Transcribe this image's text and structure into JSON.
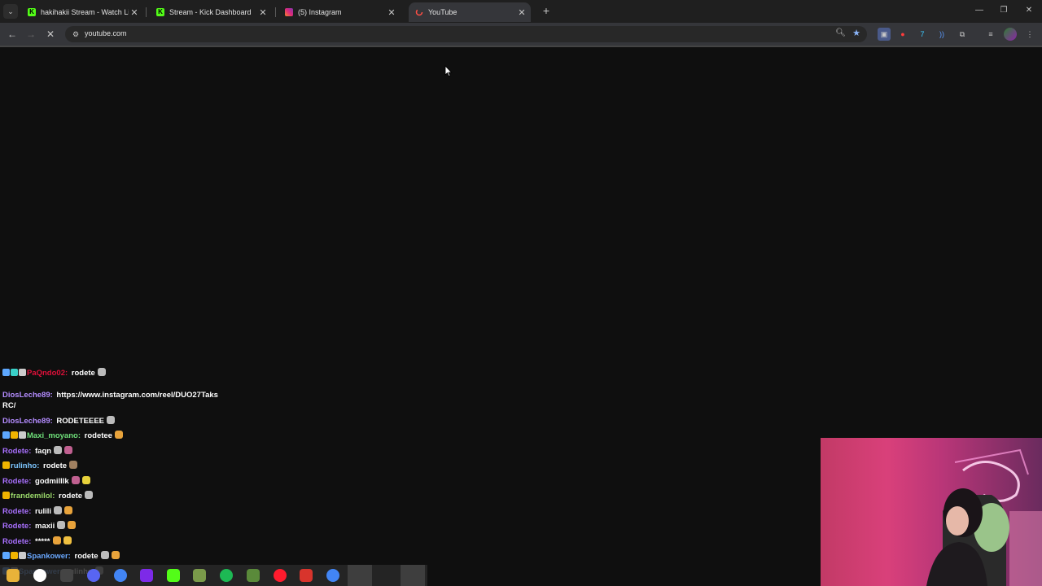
{
  "browser": {
    "tabs": [
      {
        "title": "hakihakii Stream - Watch Live o",
        "favicon": "kick",
        "favicon_color": "#53fc18",
        "active": false
      },
      {
        "title": "Stream - Kick Dashboard",
        "favicon": "kick",
        "favicon_color": "#53fc18",
        "active": false
      },
      {
        "title": "(5) Instagram",
        "favicon": "instagram",
        "favicon_color": "#e1306c",
        "active": false
      },
      {
        "title": "YouTube",
        "favicon": "youtube",
        "favicon_color": "#ff0000",
        "active": true
      }
    ],
    "close_glyph": "✕",
    "new_tab_glyph": "+",
    "window_controls": {
      "minimize": "—",
      "restore": "❐",
      "close": "✕"
    },
    "address": "youtube.com",
    "state": "loading"
  },
  "chat": {
    "messages": [
      {
        "user": "PaQndo02",
        "user_color": "#e0103a",
        "text": "rodete",
        "badges": [
          "#5da8ff",
          "#3ad0c8",
          "#cccccc"
        ],
        "emotes": [
          "#bbbbbb"
        ]
      },
      {
        "user": "DiosLeche89",
        "user_color": "#b48cff",
        "text": "https://www.instagram.com/reel/DUO27TaksRC/",
        "badges": [],
        "emotes": []
      },
      {
        "user": "DiosLeche89",
        "user_color": "#b48cff",
        "text": "RODETEEEE",
        "badges": [],
        "emotes": [
          "#bbbbbb"
        ]
      },
      {
        "user": "Maxi_moyano",
        "user_color": "#6fe07a",
        "text": "rodetee",
        "badges": [
          "#5da8ff",
          "#f0b400",
          "#cccccc"
        ],
        "emotes": [
          "#e8a33b"
        ]
      },
      {
        "user": "Rodete",
        "user_color": "#a970ff",
        "text": "faqn",
        "badges": [],
        "emotes": [
          "#bbbbbb",
          "#c06090"
        ]
      },
      {
        "user": "rulinho",
        "user_color": "#7dc6ff",
        "text": "rodete",
        "badges": [
          "#f0b400"
        ],
        "emotes": [
          "#a08060"
        ]
      },
      {
        "user": "Rodete",
        "user_color": "#a970ff",
        "text": "godmilllk",
        "badges": [],
        "emotes": [
          "#c06090",
          "#e8d23b"
        ]
      },
      {
        "user": "frandemilol",
        "user_color": "#9ad86a",
        "text": "rodete",
        "badges": [
          "#f0b400"
        ],
        "emotes": [
          "#bbbbbb"
        ]
      },
      {
        "user": "Rodete",
        "user_color": "#a970ff",
        "text": "rulili",
        "badges": [],
        "emotes": [
          "#bbbbbb",
          "#e8a33b"
        ]
      },
      {
        "user": "Rodete",
        "user_color": "#a970ff",
        "text": "maxii",
        "badges": [],
        "emotes": [
          "#bbbbbb",
          "#e8a33b"
        ]
      },
      {
        "user": "Rodete",
        "user_color": "#a970ff",
        "text": "*****",
        "badges": [],
        "emotes": [
          "#e8a33b",
          "#f0c040"
        ]
      },
      {
        "user": "Spankower",
        "user_color": "#6aa8ff",
        "text": "rodete",
        "badges": [
          "#5da8ff",
          "#f0b400",
          "#cccccc"
        ],
        "emotes": [
          "#bbbbbb",
          "#e8a33b"
        ]
      },
      {
        "user": "Spankower",
        "user_color": "#6aa8ff",
        "text": "rulinho",
        "badges": [
          "#5da8ff",
          "#cccccc"
        ],
        "emotes": [
          "#bbbbbb"
        ]
      }
    ]
  },
  "taskbar": {
    "apps": [
      {
        "name": "file-explorer",
        "color": "#e8b339"
      },
      {
        "name": "search",
        "color": "#ffffff"
      },
      {
        "name": "obs",
        "color": "#444444"
      },
      {
        "name": "discord-a",
        "color": "#5865f2"
      },
      {
        "name": "chrome-a",
        "color": "#4285f4"
      },
      {
        "name": "canva",
        "color": "#7d2ae8"
      },
      {
        "name": "kick",
        "color": "#53fc18"
      },
      {
        "name": "minecraft",
        "color": "#7a9a4a"
      },
      {
        "name": "spotify",
        "color": "#1db954"
      },
      {
        "name": "app-green",
        "color": "#5a8a3a"
      },
      {
        "name": "opera",
        "color": "#ff1b2d"
      },
      {
        "name": "youtube-maker",
        "color": "#d8342c"
      },
      {
        "name": "chrome-b",
        "color": "#4285f4"
      }
    ]
  },
  "colors": {
    "page_bg": "#0f0f0f",
    "tabstrip_bg": "#1f1f1f",
    "toolbar_bg": "#35363a"
  }
}
